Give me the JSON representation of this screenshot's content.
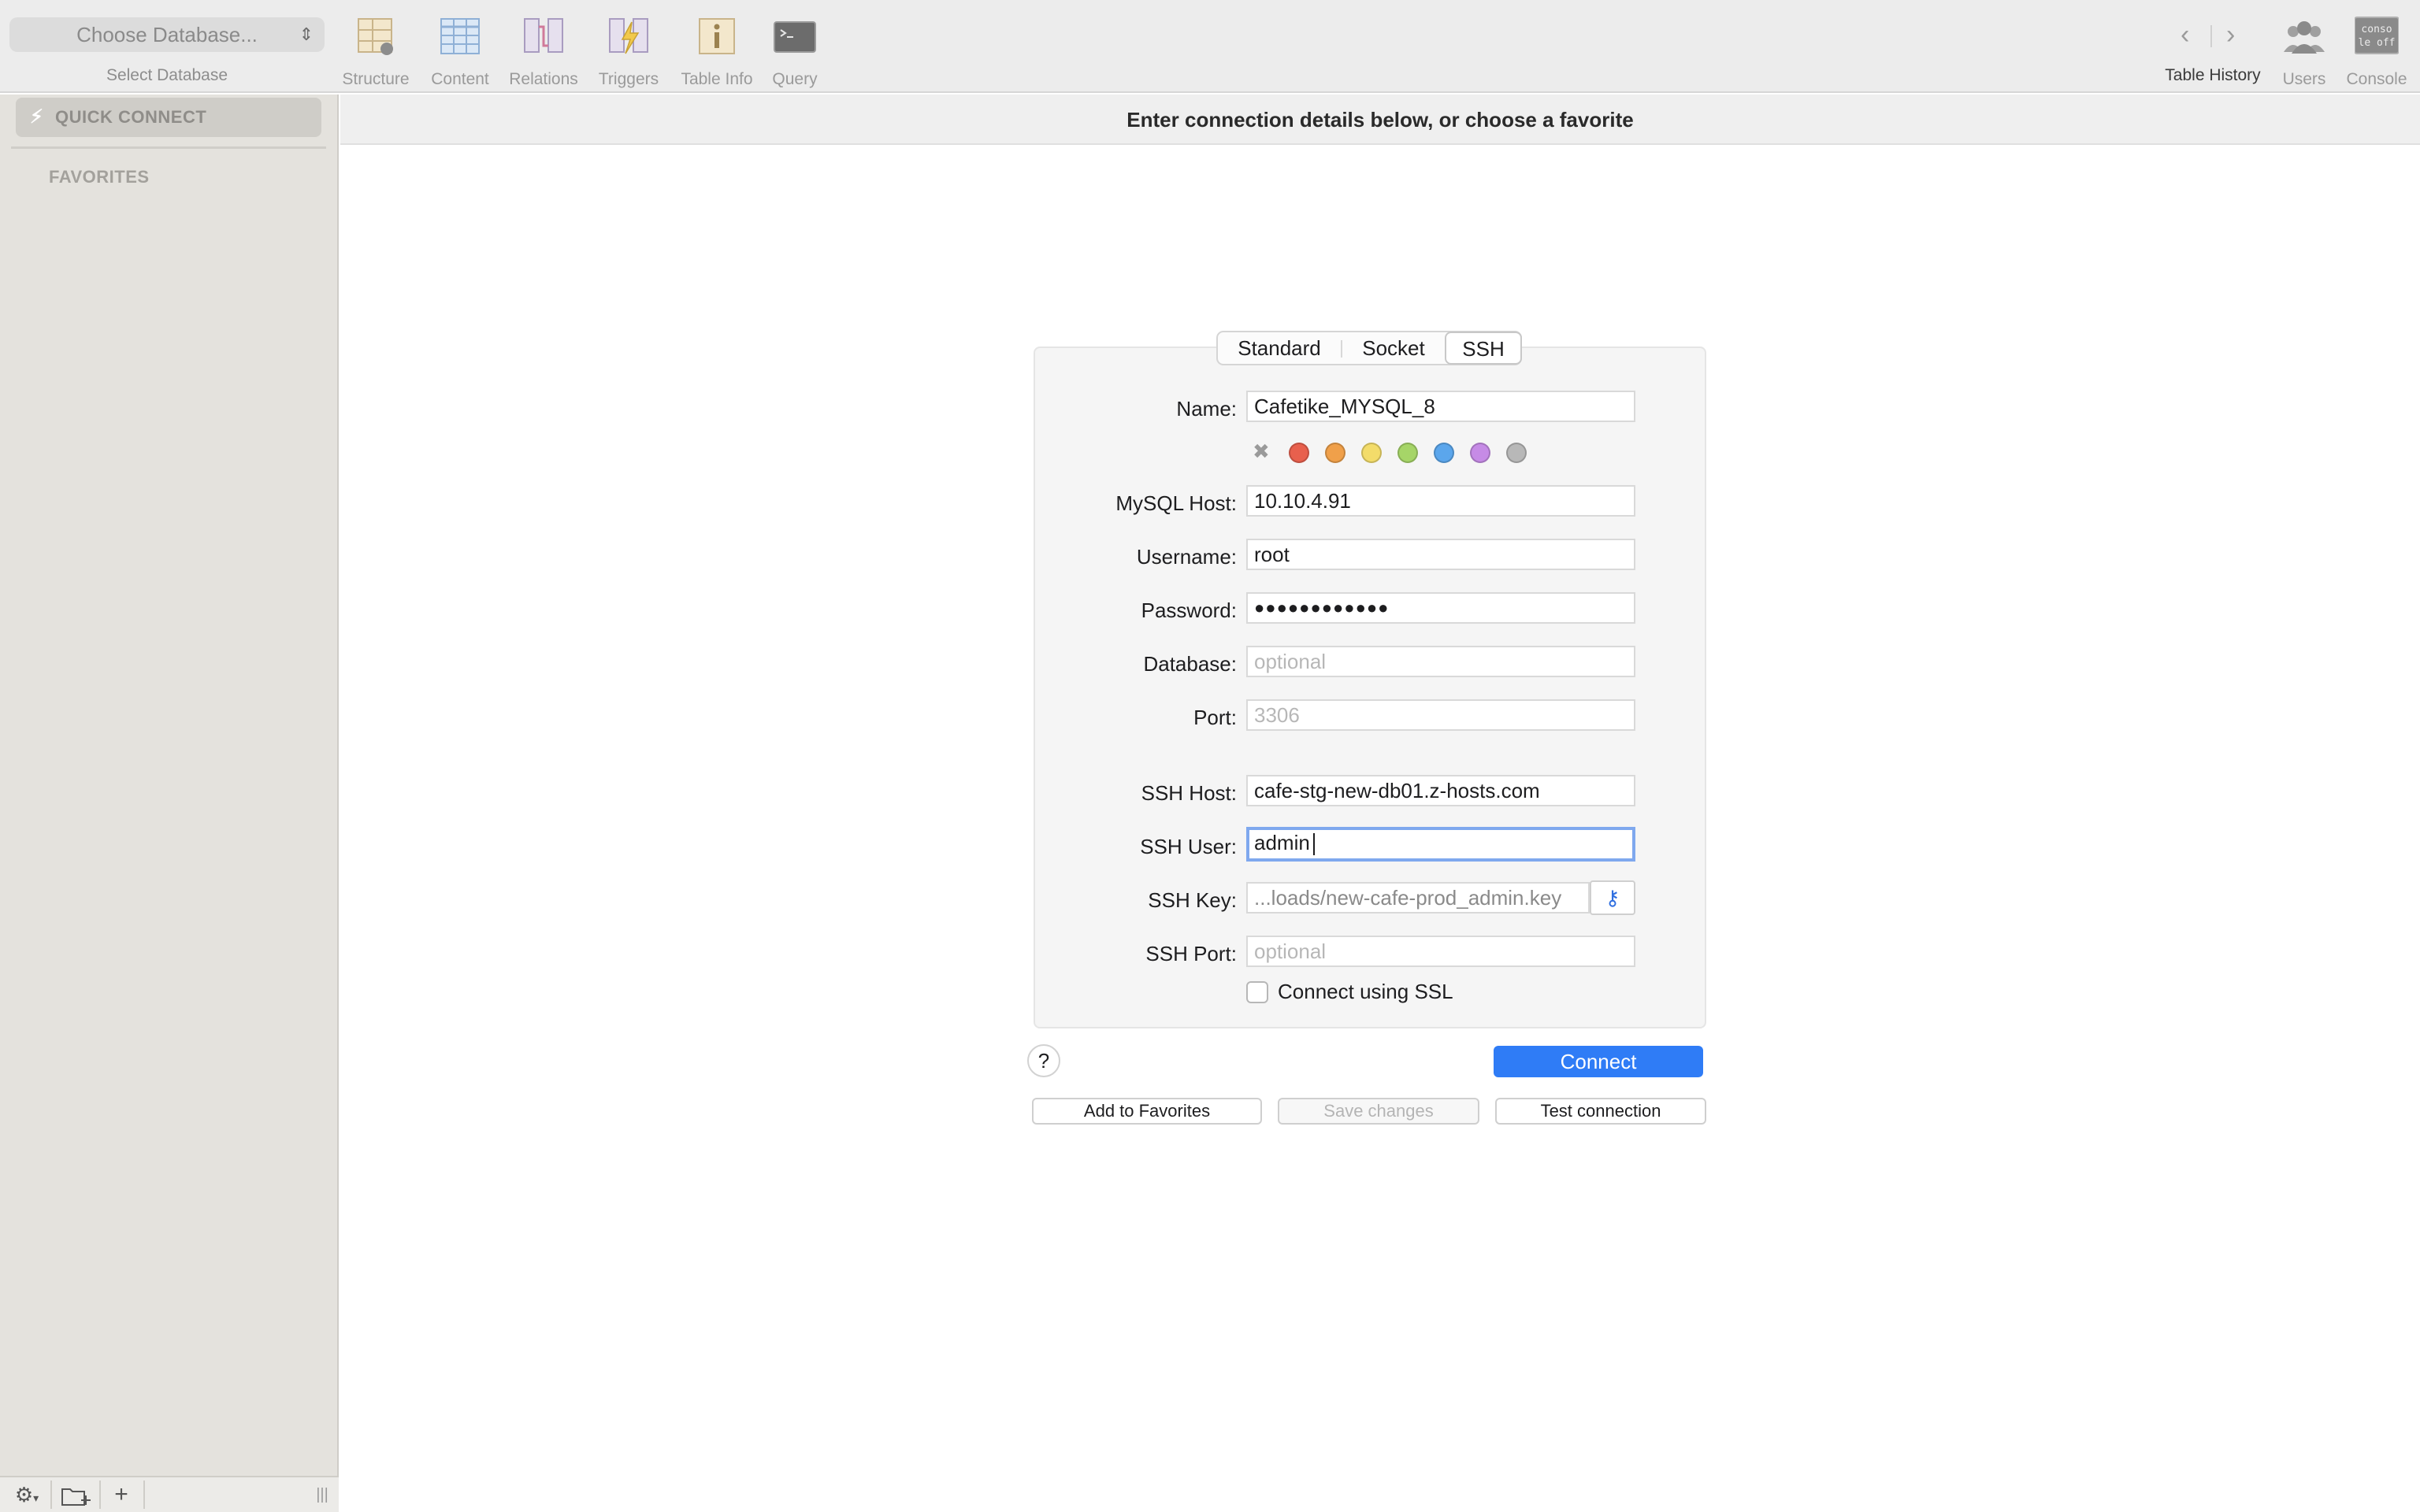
{
  "toolbar": {
    "db_select": {
      "placeholder": "Choose Database...",
      "caption": "Select Database"
    },
    "tools": [
      {
        "label": "Structure",
        "icon": "structure-icon"
      },
      {
        "label": "Content",
        "icon": "content-icon"
      },
      {
        "label": "Relations",
        "icon": "relations-icon"
      },
      {
        "label": "Triggers",
        "icon": "triggers-icon"
      },
      {
        "label": "Table Info",
        "icon": "table-info-icon"
      },
      {
        "label": "Query",
        "icon": "query-icon"
      }
    ],
    "right_tools": [
      {
        "label": "Table History",
        "icon": "table-history-icon"
      },
      {
        "label": "Users",
        "icon": "users-icon"
      },
      {
        "label": "Console",
        "icon": "console-icon",
        "icon_text": "conso le off"
      }
    ]
  },
  "sidebar": {
    "quick_connect": "QUICK CONNECT",
    "favorites_header": "FAVORITES",
    "bottom": [
      "gear-menu-icon",
      "new-folder-icon",
      "add-icon",
      "resize-handle-icon"
    ]
  },
  "header": {
    "title": "Enter connection details below, or choose a favorite"
  },
  "connection": {
    "tabs": [
      "Standard",
      "Socket",
      "SSH"
    ],
    "active_tab": "SSH",
    "labels": {
      "name": "Name:",
      "host": "MySQL Host:",
      "username": "Username:",
      "password": "Password:",
      "database": "Database:",
      "port": "Port:",
      "ssh_host": "SSH Host:",
      "ssh_user": "SSH User:",
      "ssh_key": "SSH Key:",
      "ssh_port": "SSH Port:"
    },
    "values": {
      "name": "Cafetike_MYSQL_8",
      "host": "10.10.4.91",
      "username": "root",
      "password": "●●●●●●●●●●●●",
      "database_placeholder": "optional",
      "port_placeholder": "3306",
      "ssh_host": "cafe-stg-new-db01.z-hosts.com",
      "ssh_user": "admin",
      "ssh_key": "...loads/new-cafe-prod_admin.key",
      "ssh_port_placeholder": "optional"
    },
    "color_labels": [
      "none",
      "red",
      "orange",
      "yellow",
      "green",
      "blue",
      "purple",
      "gray"
    ],
    "colors": [
      "#e8604d",
      "#f0a04a",
      "#f3dc6a",
      "#a6d568",
      "#5ba6ec",
      "#c68be6",
      "#b8b8b8"
    ],
    "ssl_label": "Connect using SSL",
    "ssl_checked": false,
    "help": "?",
    "connect": "Connect",
    "add_favorite": "Add to Favorites",
    "save_changes": "Save changes",
    "test_connection": "Test connection"
  }
}
